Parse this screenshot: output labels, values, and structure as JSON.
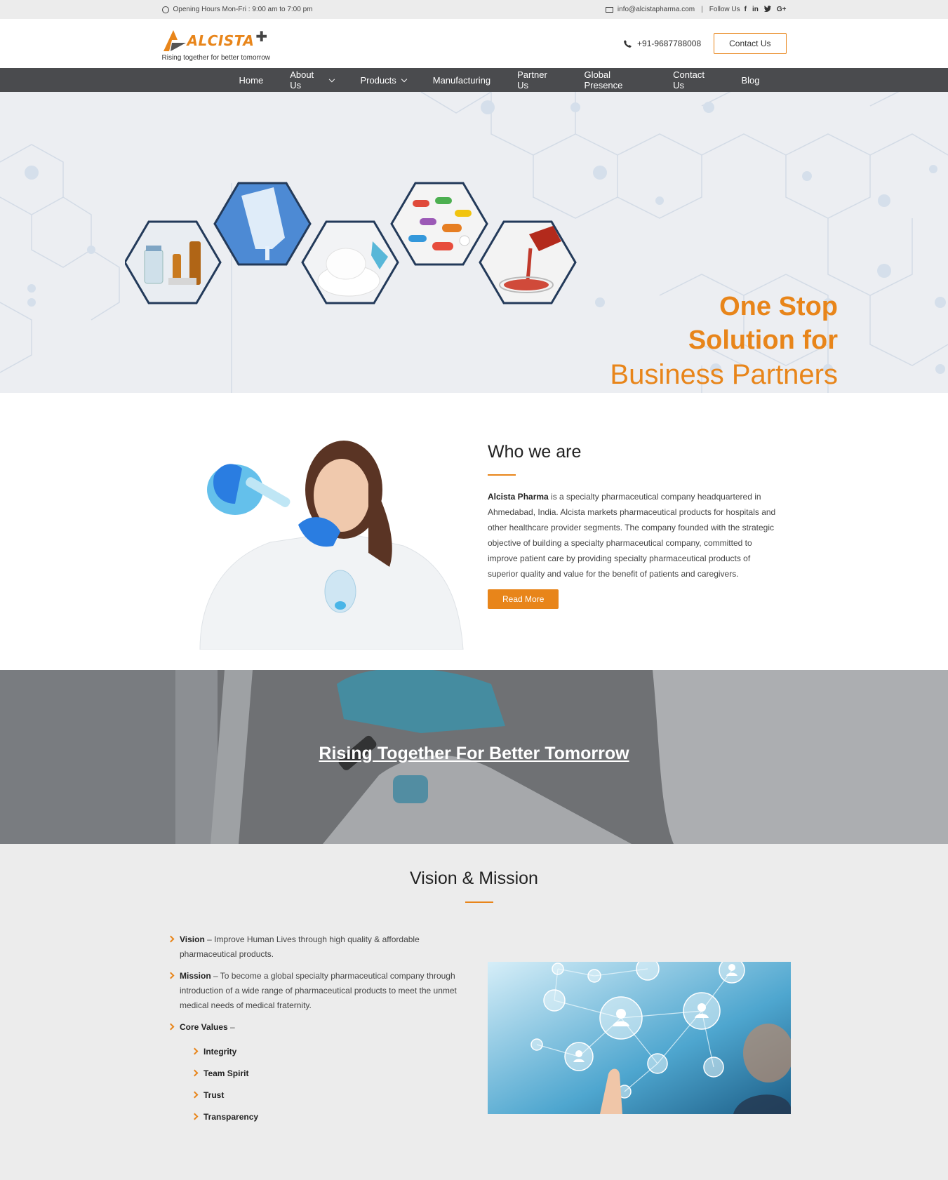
{
  "topbar": {
    "hours": "Opening Hours Mon-Fri : 9:00 am to 7:00 pm",
    "email": "info@alcistapharma.com",
    "separator": "|",
    "follow": "Follow Us",
    "social": [
      "f",
      "in",
      "t",
      "G+"
    ]
  },
  "header": {
    "logo_name": "ALCISTA",
    "logo_tagline": "Rising together for better tomorrow",
    "phone": "+91-9687788008",
    "contact_button": "Contact Us"
  },
  "nav": {
    "items": [
      {
        "label": "Home"
      },
      {
        "label": "About Us"
      },
      {
        "label": "Products"
      },
      {
        "label": "Manufacturing"
      },
      {
        "label": "Partner Us"
      },
      {
        "label": "Global Presence"
      },
      {
        "label": "Contact Us"
      },
      {
        "label": "Blog"
      }
    ]
  },
  "hero": {
    "line1": "One Stop",
    "line2": "Solution for",
    "line3": "Business Partners"
  },
  "who": {
    "title": "Who we are",
    "company": "Alcista Pharma",
    "body": " is a specialty pharmaceutical company headquartered in Ahmedabad, India. Alcista markets pharmaceutical products for hospitals and other healthcare provider segments. The company founded with the strategic objective of building a specialty pharmaceutical company, committed to improve patient care by providing specialty pharmaceutical products of superior quality and value for the benefit of patients and caregivers.",
    "button": "Read More"
  },
  "banner": {
    "title": "Rising Together For Better Tomorrow"
  },
  "vision": {
    "title": "Vision & Mission",
    "items": [
      {
        "term": "Vision",
        "text": " – Improve Human Lives through high quality & affordable pharmaceutical products."
      },
      {
        "term": "Mission",
        "text": " – To become a global specialty pharmaceutical company through introduction of a wide range of pharmaceutical products to meet the unmet medical needs of medical fraternity."
      },
      {
        "term": "Core Values",
        "text": " –"
      }
    ],
    "core_values": [
      "Integrity",
      "Team Spirit",
      "Trust",
      "Transparency"
    ]
  },
  "colors": {
    "accent": "#e8851a",
    "nav_bg": "#4a4b4e",
    "topbar_bg": "#ececec"
  }
}
